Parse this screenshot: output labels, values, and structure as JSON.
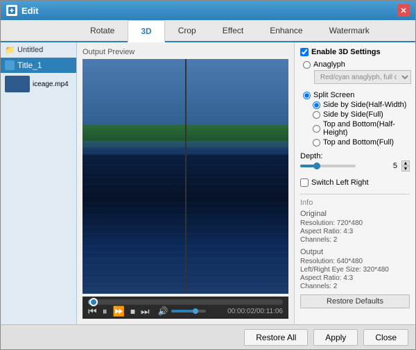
{
  "window": {
    "title": "Edit",
    "close_label": "✕"
  },
  "tabs": [
    {
      "id": "rotate",
      "label": "Rotate"
    },
    {
      "id": "3d",
      "label": "3D",
      "active": true
    },
    {
      "id": "crop",
      "label": "Crop"
    },
    {
      "id": "effect",
      "label": "Effect"
    },
    {
      "id": "enhance",
      "label": "Enhance"
    },
    {
      "id": "watermark",
      "label": "Watermark"
    }
  ],
  "sidebar": {
    "untitled_label": "Untitled",
    "title1_label": "Title_1",
    "file_label": "iceage.mp4"
  },
  "preview": {
    "label": "Output Preview"
  },
  "controls": {
    "time": "00:00:02/00:11:06"
  },
  "settings": {
    "enable_3d_label": "Enable 3D Settings",
    "anaglyph_label": "Anaglyph",
    "anaglyph_option": "Red/cyan anaglyph, full color",
    "split_screen_label": "Split Screen",
    "side_by_side_half_label": "Side by Side(Half-Width)",
    "side_by_side_full_label": "Side by Side(Full)",
    "top_bottom_half_label": "Top and Bottom(Half-Height)",
    "top_bottom_full_label": "Top and Bottom(Full)",
    "depth_label": "Depth:",
    "depth_value": "5",
    "switch_lr_label": "Switch Left Right"
  },
  "info": {
    "section_label": "Info",
    "original_label": "Original",
    "original_resolution": "Resolution: 720*480",
    "original_aspect": "Aspect Ratio: 4:3",
    "original_channels": "Channels: 2",
    "output_label": "Output",
    "output_resolution": "Resolution: 640*480",
    "output_eye_size": "Left/Right Eye Size: 320*480",
    "output_aspect": "Aspect Ratio: 4:3",
    "output_channels": "Channels: 2",
    "restore_defaults": "Restore Defaults"
  },
  "bottom": {
    "restore_all": "Restore All",
    "apply": "Apply",
    "close": "Close"
  }
}
